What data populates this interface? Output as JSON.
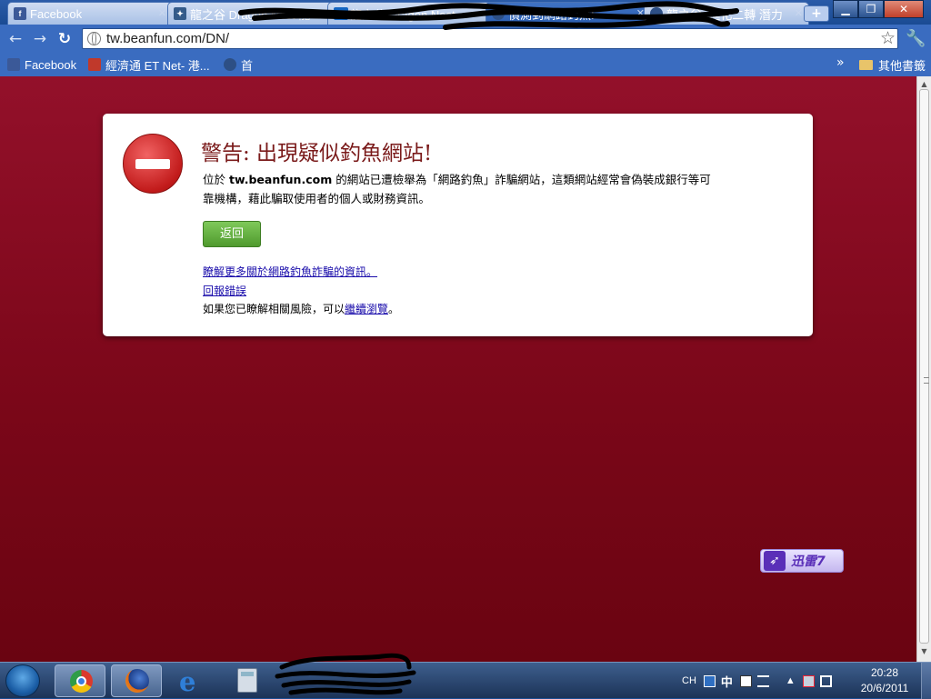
{
  "tabs": [
    {
      "title": "Facebook",
      "favicon": "facebook-icon",
      "favicon_text": "f",
      "favicon_color": "#3b5998",
      "active": false
    },
    {
      "title": "龍之谷 Dragon Nest 龍",
      "favicon": "dragon-icon",
      "favicon_text": "",
      "favicon_color": "#345b8a",
      "active": false
    },
    {
      "title": "龍之谷 Dragon Nest -",
      "favicon": "2kf-icon",
      "favicon_text": "2KF",
      "favicon_color": "#1565c0",
      "active": false
    },
    {
      "title": "偵測到網路釣魚!",
      "favicon": "globe-icon",
      "favicon_text": "",
      "favicon_color": "#2d4f85",
      "active": true
    },
    {
      "title": "龍之谷_進化二轉 潛力",
      "favicon": "globe-icon",
      "favicon_text": "",
      "favicon_color": "#2d4f85",
      "active": false
    }
  ],
  "toolbar": {
    "url": "tw.beanfun.com/DN/"
  },
  "bookmarks": {
    "items": [
      {
        "label": "Facebook",
        "icon": "facebook-icon",
        "color": "#3b5998"
      },
      {
        "label": "經濟通 ET Net- 港...",
        "icon": "etnet-icon",
        "color": "#c0392b"
      },
      {
        "label": "首",
        "icon": "globe-icon",
        "color": "#2d4f85"
      }
    ],
    "other_label": "其他書籤"
  },
  "warning": {
    "title": "警告: 出現疑似釣魚網站!",
    "body_prefix": "位於 ",
    "body_site": "tw.beanfun.com",
    "body_suffix": " 的網站已遭檢舉為「網路釣魚」詐騙網站，這類網站經常會偽裝成銀行等可靠機構，藉此騙取使用者的個人或財務資訊。",
    "back_label": "返回",
    "learn_more_link": "瞭解更多關於網路釣魚詐騙的資訊。",
    "report_error_link": "回報錯誤",
    "proceed_prefix": "如果您已瞭解相關風險，可以",
    "proceed_link": "繼續瀏覽",
    "proceed_suffix": "。"
  },
  "xunlei": {
    "label": "迅雷7"
  },
  "taskbar": {
    "pinned": [
      "chrome-icon",
      "firefox-icon",
      "ie-icon",
      "calculator-icon"
    ],
    "tray": {
      "lang": "CH",
      "ime": "中"
    },
    "time": "20:28",
    "date": "20/6/2011"
  },
  "colors": {
    "page_background": "#7b0719",
    "warning_title": "#7a1a1a",
    "back_button": "#5fa83b",
    "link": "#1a0dab",
    "chrome_frame": "#3a6cc0"
  }
}
